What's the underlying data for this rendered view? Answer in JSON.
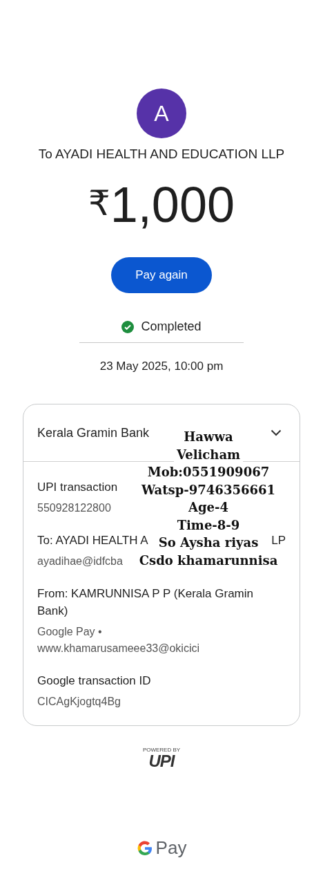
{
  "avatar": {
    "letter": "A",
    "color": "#5632a8"
  },
  "recipient": "To AYADI HEALTH AND EDUCATION LLP",
  "amount": {
    "currency": "₹",
    "value": "1,000"
  },
  "pay_again_button": "Pay again",
  "status": {
    "label": "Completed",
    "kind": "success"
  },
  "date": "23 May 2025, 10:00 pm",
  "details_card": {
    "bank": "Kerala Gramin Bank",
    "expanded": true,
    "rows": [
      {
        "label": "UPI transaction",
        "label_tail": "",
        "value": "550928122800"
      },
      {
        "label": "To: AYADI HEALTH A",
        "label_tail": "LP",
        "value": "ayadihae@idfcba"
      },
      {
        "label": "From: KAMRUNNISA P P (Kerala Gramin Bank)",
        "label_tail": "",
        "value": "Google Pay • www.khamarusameee33@okicici"
      },
      {
        "label": "Google transaction ID",
        "label_tail": "",
        "value": "CICAgKjogtq4Bg"
      }
    ],
    "note_lines": [
      "Hawwa",
      "Velicham",
      "Mob:0551909067",
      "Watsp-9746356661",
      "Age-4",
      "Time-8-9",
      "So Aysha riyas",
      "Csdo khamarunnisa"
    ]
  },
  "powered_by": {
    "caption": "POWERED BY",
    "logo": "UPI"
  },
  "brand": {
    "name": "Pay"
  }
}
